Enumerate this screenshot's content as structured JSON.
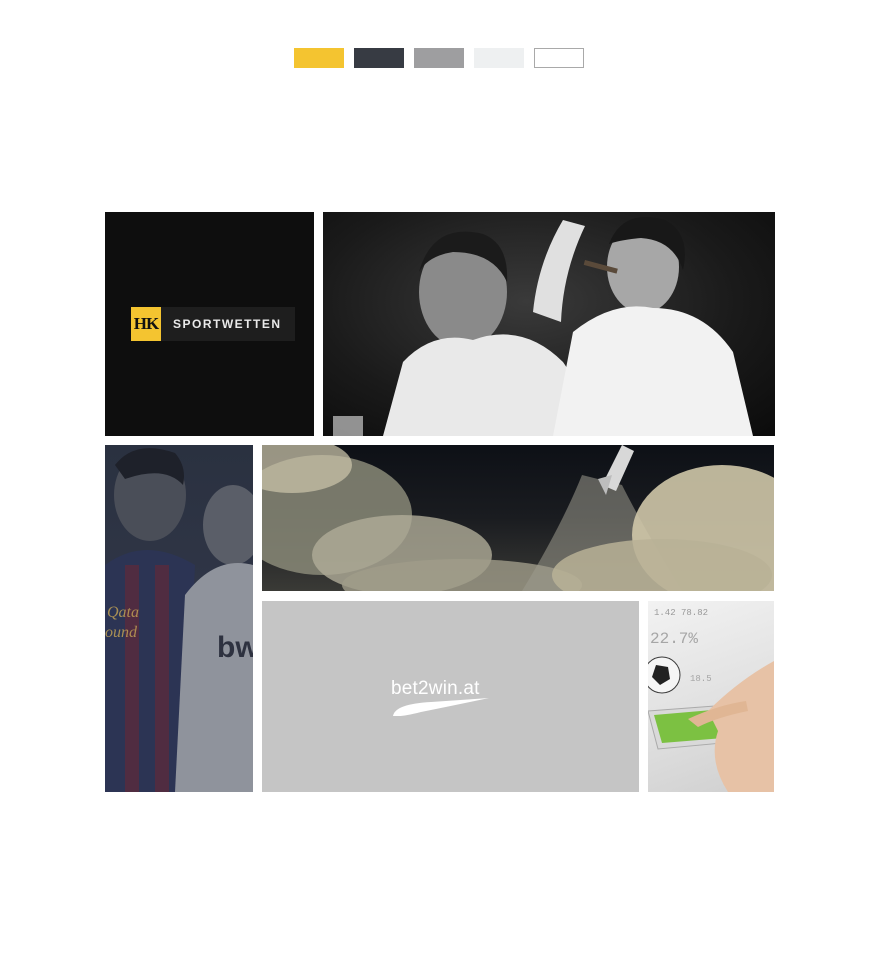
{
  "palette": {
    "colors": [
      "#f4c430",
      "#373b43",
      "#9e9ea0",
      "#eef0f1",
      "#ffffff"
    ],
    "border_color": "#a9a9a9"
  },
  "logo": {
    "mark": "HK",
    "text": "SPORTWETTEN",
    "accent": "#f4c430"
  },
  "photos": {
    "men": "photo-men-celebrating",
    "football": "photo-football-players",
    "rocket": "photo-rocket-launch",
    "tablet": "photo-tablet-soccer"
  },
  "bet2win": {
    "text": "bet2win.at"
  }
}
